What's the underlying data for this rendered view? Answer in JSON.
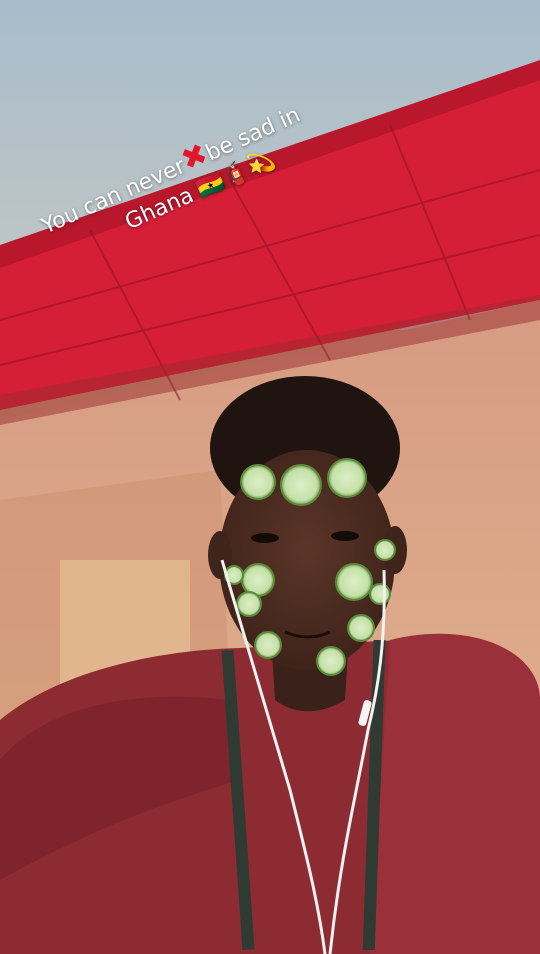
{
  "caption": {
    "line1_part1": "You can never",
    "cross_emoji": "✖",
    "line1_part2": "be sad in",
    "line2_text": "Ghana",
    "emojis": "🇬🇭🧯💫"
  },
  "colors": {
    "sky": "#aebfcb",
    "canopy": "#d8203a",
    "wall": "#d9a285",
    "shirt": "#8e2a33",
    "skin": "#4a2b22",
    "cucumber": "#c9e2b0"
  }
}
